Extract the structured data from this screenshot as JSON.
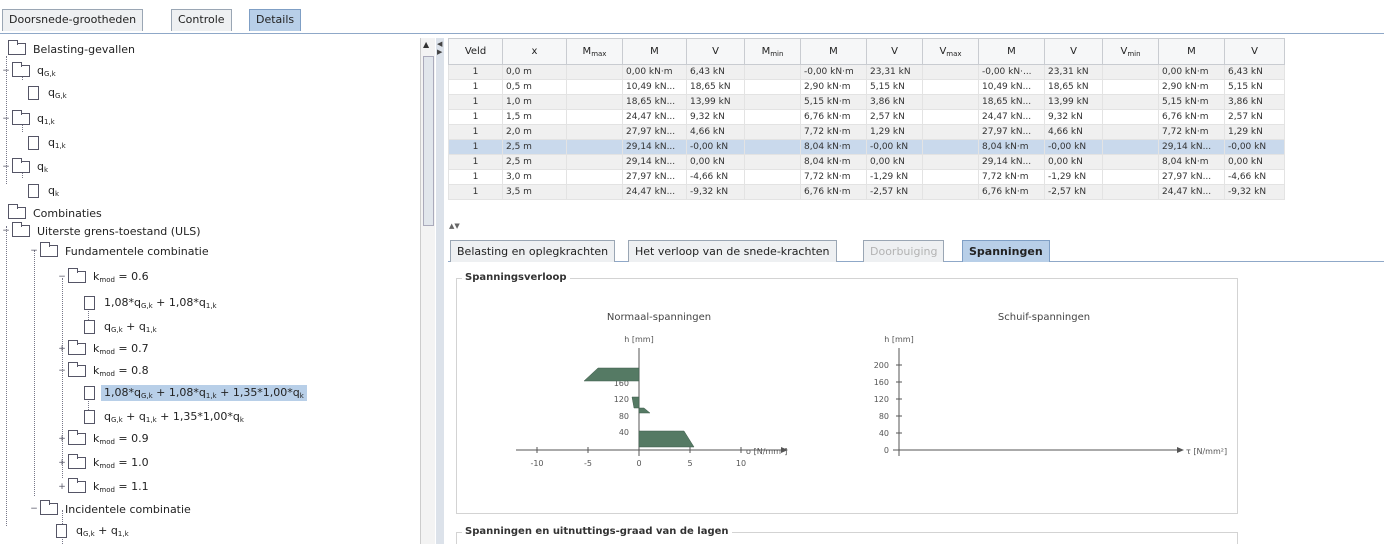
{
  "top_tabs": [
    {
      "label": "Doorsnede-grootheden",
      "active": false
    },
    {
      "label": "Controle",
      "active": false
    },
    {
      "label": "Details",
      "active": true
    }
  ],
  "tree": {
    "belasting_gevallen": "Belasting-gevallen",
    "case1": "q",
    "case1_sub": "G,k",
    "case1_child": "q",
    "case1_child_sub": "G,k",
    "case2": "q",
    "case2_sub": "1,k",
    "case2_child": "q",
    "case2_child_sub": "1,k",
    "case3": "q",
    "case3_sub": "k",
    "case3_child": "q",
    "case3_child_sub": "k",
    "combinaties": "Combinaties",
    "uls": "Uiterste grens-toestand (ULS)",
    "fundamentele": "Fundamentele combinatie",
    "kmod_06": "= 0.6",
    "kmod_06_a": "1,08*q",
    "kmod_06_b": "q",
    "kmod_07": "= 0.7",
    "kmod_08": "= 0.8",
    "kmod_08_a": "1,08*q",
    "kmod_08_b": "q",
    "kmod_09": "= 0.9",
    "kmod_10": "= 1.0",
    "kmod_11": "= 1.1",
    "incidentele": "Incidentele combinatie",
    "inc_a": "q",
    "inc_b": "q",
    "k_label": "k",
    "k_sub": "mod"
  },
  "table": {
    "headers": [
      "Veld",
      "x",
      "M",
      "M",
      "V",
      "M",
      "M",
      "V",
      "V",
      "M",
      "V",
      "V",
      "M",
      "V"
    ],
    "header_subs": [
      "",
      "",
      "max",
      "",
      "",
      "min",
      "",
      "",
      "max",
      "",
      "",
      "min",
      "",
      ""
    ],
    "rows": [
      [
        "1",
        "0,0 m",
        "",
        "0,00 kN·m",
        "6,43 kN",
        "",
        "-0,00 kN·m",
        "23,31 kN",
        "",
        "-0,00 kN·...",
        "23,31 kN",
        "",
        "0,00 kN·m",
        "6,43 kN"
      ],
      [
        "1",
        "0,5 m",
        "",
        "10,49 kN...",
        "18,65 kN",
        "",
        "2,90 kN·m",
        "5,15 kN",
        "",
        "10,49 kN...",
        "18,65 kN",
        "",
        "2,90 kN·m",
        "5,15 kN"
      ],
      [
        "1",
        "1,0 m",
        "",
        "18,65 kN...",
        "13,99 kN",
        "",
        "5,15 kN·m",
        "3,86 kN",
        "",
        "18,65 kN...",
        "13,99 kN",
        "",
        "5,15 kN·m",
        "3,86 kN"
      ],
      [
        "1",
        "1,5 m",
        "",
        "24,47 kN...",
        "9,32 kN",
        "",
        "6,76 kN·m",
        "2,57 kN",
        "",
        "24,47 kN...",
        "9,32 kN",
        "",
        "6,76 kN·m",
        "2,57 kN"
      ],
      [
        "1",
        "2,0 m",
        "",
        "27,97 kN...",
        "4,66 kN",
        "",
        "7,72 kN·m",
        "1,29 kN",
        "",
        "27,97 kN...",
        "4,66 kN",
        "",
        "7,72 kN·m",
        "1,29 kN"
      ],
      [
        "1",
        "2,5 m",
        "",
        "29,14 kN...",
        "-0,00 kN",
        "",
        "8,04 kN·m",
        "-0,00 kN",
        "",
        "8,04 kN·m",
        "-0,00 kN",
        "",
        "29,14 kN...",
        "-0,00 kN"
      ],
      [
        "1",
        "2,5 m",
        "",
        "29,14 kN...",
        "0,00 kN",
        "",
        "8,04 kN·m",
        "0,00 kN",
        "",
        "29,14 kN...",
        "0,00 kN",
        "",
        "8,04 kN·m",
        "0,00 kN"
      ],
      [
        "1",
        "3,0 m",
        "",
        "27,97 kN...",
        "-4,66 kN",
        "",
        "7,72 kN·m",
        "-1,29 kN",
        "",
        "7,72 kN·m",
        "-1,29 kN",
        "",
        "27,97 kN...",
        "-4,66 kN"
      ],
      [
        "1",
        "3,5 m",
        "",
        "24,47 kN...",
        "-9,32 kN",
        "",
        "6,76 kN·m",
        "-2,57 kN",
        "",
        "6,76 kN·m",
        "-2,57 kN",
        "",
        "24,47 kN...",
        "-9,32 kN"
      ]
    ],
    "selected_row": 5
  },
  "lower_tabs": [
    {
      "label": "Belasting en oplegkrachten",
      "state": "normal"
    },
    {
      "label": "Het verloop van de snede-krachten",
      "state": "normal"
    },
    {
      "label": "Doorbuiging",
      "state": "disabled"
    },
    {
      "label": "Spanningen",
      "state": "active"
    }
  ],
  "spanningsverloop": {
    "group_title": "Spanningsverloop",
    "normaal": {
      "title": "Normaal-spanningen",
      "y_label": "h [mm]",
      "x_label": "σ [N/mm²]",
      "x_ticks": [
        "-10",
        "-5",
        "0",
        "5",
        "10"
      ],
      "y_ticks": [
        "160",
        "120",
        "80",
        "40"
      ]
    },
    "schuif": {
      "title": "Schuif-spanningen",
      "y_label": "h [mm]",
      "x_label": "τ [N/mm²]",
      "y_ticks": [
        "200",
        "160",
        "120",
        "80",
        "40",
        "0"
      ]
    }
  },
  "lagen_group_title": "Spanningen en uitnuttings-graad van de lagen",
  "colors": {
    "tab_active": "#b8cfe8",
    "selection": "#c9d9ec",
    "stress_fill": "#557a64"
  }
}
